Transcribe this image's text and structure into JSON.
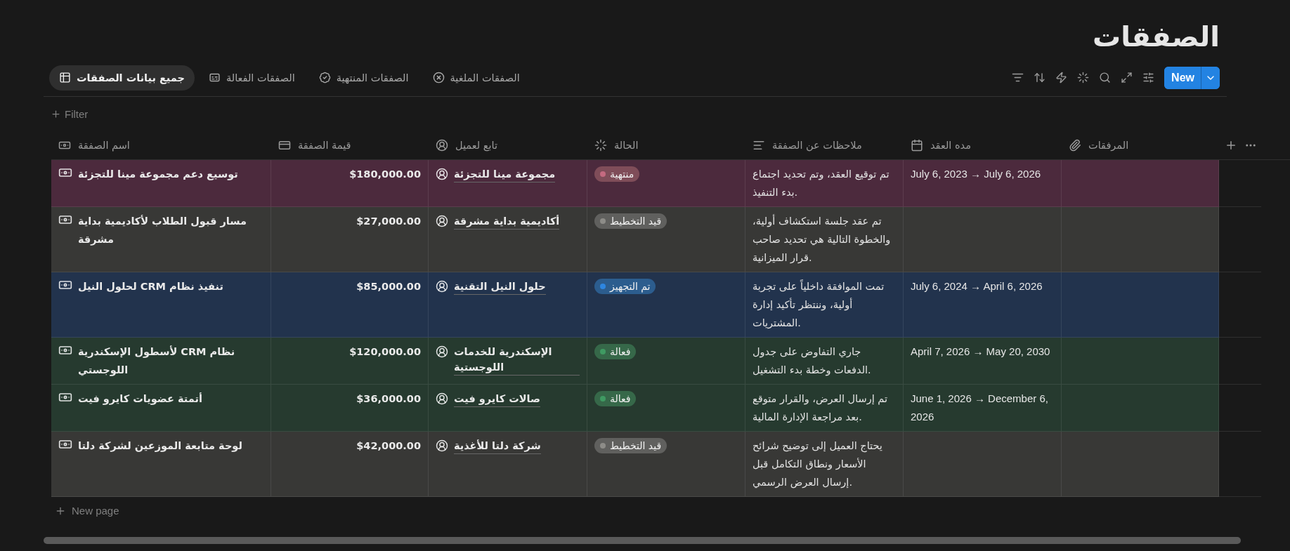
{
  "page": {
    "title": "الصفقات"
  },
  "tabs": [
    {
      "label": "الصفقات الملغية",
      "selected": false
    },
    {
      "label": "الصفقات المنتهية",
      "selected": false
    },
    {
      "label": "الصفقات الفعالة",
      "selected": false
    },
    {
      "label": "جميع بيانات الصفقات",
      "selected": true
    }
  ],
  "toolbar": {
    "new_button": "New"
  },
  "filter": {
    "label": "Filter"
  },
  "table": {
    "columns": [
      {
        "label": "المرفقات"
      },
      {
        "label": "مده العقد"
      },
      {
        "label": "ملاحظات عن الصفقة"
      },
      {
        "label": "الحالة"
      },
      {
        "label": "تابع لعميل"
      },
      {
        "label": "قيمة الصفقة"
      },
      {
        "label": "اسم الصفقة"
      }
    ],
    "rows": [
      {
        "color": "#4c2a3d",
        "name": "توسيع دعم مجموعة مينا للتجزئة",
        "value": "$180,000.00",
        "client": "مجموعة مينا للتجزئة",
        "status": {
          "label": "منتهية",
          "color": "#c46a80"
        },
        "notes": "تم توقيع العقد، وتم تحديد اجتماع بدء التنفيذ.",
        "duration": "July 6, 2023 → July 6, 2026"
      },
      {
        "color": "#383836",
        "name": "مسار قبول الطلاب لأكاديمية بداية مشرقة",
        "value": "$27,000.00",
        "client": "أكاديمية بداية مشرقة",
        "status": {
          "label": "قيد التخطيط",
          "color": "#8d8c88"
        },
        "notes": "تم عقد جلسة استكشاف أولية، والخطوة التالية هي تحديد صاحب قرار الميزانية."
      },
      {
        "color": "#22334d",
        "name": "لحلول النيل CRM تنفيذ نظام",
        "value": "$85,000.00",
        "client": "حلول النيل التقنية",
        "status": {
          "label": "تم التجهيز",
          "color": "#2e86e0"
        },
        "notes": "تمت الموافقة داخلياً على تجربة أولية، وننتظر تأكيد إدارة المشتريات.",
        "duration": "July 6, 2024 → April 6, 2026"
      },
      {
        "color": "#263a2f",
        "name": "لأسطول الإسكندرية CRM نظام اللوجستي",
        "value": "$120,000.00",
        "client": "الإسكندرية للخدمات اللوجستية",
        "status": {
          "label": "فعالة",
          "color": "#3f9a62"
        },
        "notes": "جاري التفاوض على جدول الدفعات وخطة بدء التشغيل.",
        "duration": "April 7, 2026 → May 20, 2030"
      },
      {
        "color": "#263a2f",
        "name": "أتمتة عضويات كايرو فيت",
        "value": "$36,000.00",
        "client": "صالات كايرو فيت",
        "status": {
          "label": "فعالة",
          "color": "#3f9a62"
        },
        "notes": "تم إرسال العرض، والقرار متوقع بعد مراجعة الإدارة المالية.",
        "duration": "June 1, 2026 → December 6, 2026"
      },
      {
        "color": "#383836",
        "name": "لوحة متابعة الموزعين لشركة دلتا",
        "value": "$42,000.00",
        "client": "شركة دلتا للأغذية",
        "status": {
          "label": "قيد التخطيط",
          "color": "#8d8c88"
        },
        "notes": "يحتاج العميل إلى توضيح شرائح الأسعار ونطاق التكامل قبل إرسال العرض الرسمي."
      }
    ]
  },
  "new_page": {
    "label": "New page"
  }
}
